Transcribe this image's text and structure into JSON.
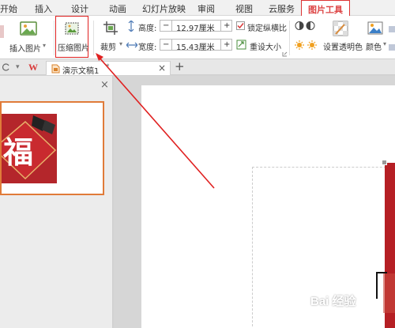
{
  "ribbon_tabs": [
    "开始",
    "插入",
    "设计",
    "动画",
    "幻灯片放映",
    "审阅",
    "视图",
    "云服务",
    "图片工具"
  ],
  "ribbon": {
    "insert_picture": "插入图片",
    "compress_picture": "压缩图片",
    "crop": "裁剪",
    "height_label": "高度:",
    "height_value": "12.97厘米",
    "width_label": "宽度:",
    "width_value": "15.43厘米",
    "minus": "−",
    "plus": "+",
    "lock_ratio": "锁定纵横比",
    "reset_size": "重设大小",
    "set_transparent": "设置透明色",
    "color": "颜色"
  },
  "document": {
    "wps_logo": "W",
    "tab_title": "演示文稿1",
    "tab_modified": "*",
    "close": "×",
    "new_tab": "+",
    "pane_close": "×",
    "thumbnail_character": "福"
  },
  "colors": {
    "accent_red": "#d93a3a",
    "annotation_red": "#e02020",
    "thumbnail_border": "#e07b39"
  },
  "watermark": "Bai 经验"
}
